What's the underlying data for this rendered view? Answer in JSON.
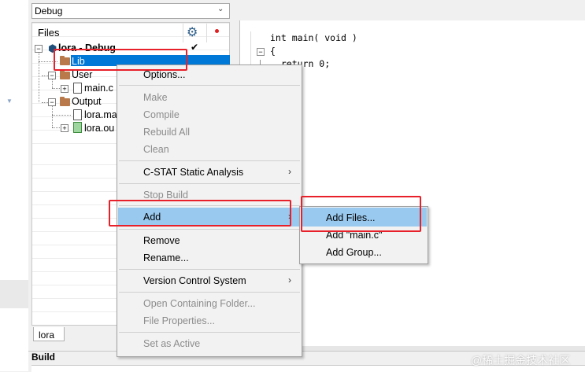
{
  "workspace": {
    "config": "Debug",
    "files_header": "Files",
    "tab_label": "lora"
  },
  "tree": {
    "project": "lora - Debug",
    "lib": "Lib",
    "user": "User",
    "main_c": "main.c",
    "output": "Output",
    "lora_map": "lora.ma",
    "lora_out": "lora.ou",
    "project_check": "✔"
  },
  "editor": {
    "lines": [
      "int main( void )",
      "{",
      "  return 0;"
    ]
  },
  "context_menu": {
    "options": "Options...",
    "make": "Make",
    "compile": "Compile",
    "rebuild_all": "Rebuild All",
    "clean": "Clean",
    "cstat": "C-STAT Static Analysis",
    "stop_build": "Stop Build",
    "add": "Add",
    "remove": "Remove",
    "rename": "Rename...",
    "version_control": "Version Control System",
    "open_folder": "Open Containing Folder...",
    "file_properties": "File Properties...",
    "set_active": "Set as Active"
  },
  "submenu": {
    "add_files": "Add Files...",
    "add_main_c": "Add \"main.c\"",
    "add_group": "Add Group..."
  },
  "build_bar": {
    "label": "Build"
  },
  "watermark": "@稀土掘金技术社区",
  "colors": {
    "selection": "#0078d7",
    "menu_hover": "#99c9ef",
    "annotation": "#e8202a",
    "folder": "#b9794a"
  }
}
